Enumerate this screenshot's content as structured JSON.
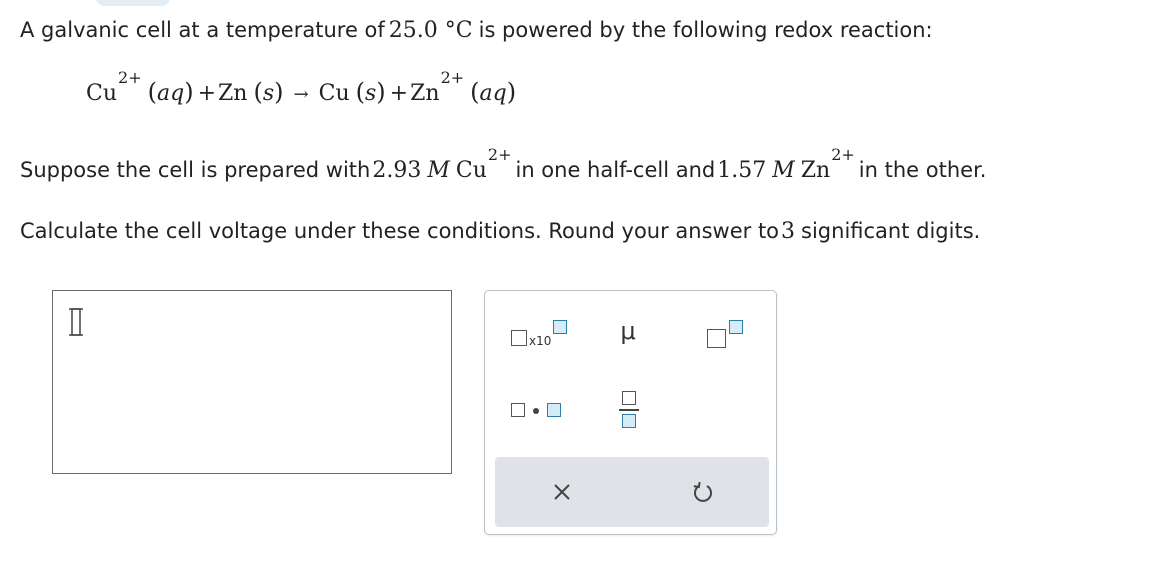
{
  "question": {
    "intro": "A galvanic cell at a temperature of 25.0 °C is powered by the following redox reaction:",
    "intro_prefix": "A galvanic cell at a temperature of ",
    "intro_temp": "25.0 °C",
    "intro_suffix": " is powered by the following redox reaction:",
    "reaction": {
      "reactant1": "Cu",
      "reactant1_charge": "2+",
      "reactant1_state": "aq",
      "plus": "+",
      "reactant2": "Zn",
      "reactant2_state": "s",
      "arrow": "→",
      "product1": "Cu",
      "product1_state": "s",
      "product2": "Zn",
      "product2_charge": "2+",
      "product2_state": "aq"
    },
    "conditions": {
      "prefix": "Suppose the cell is prepared with ",
      "conc1": "2.93",
      "unit": "M",
      "ion1": "Cu",
      "ion1_charge": "2+",
      "middle": " in one half-cell and ",
      "conc2": "1.57",
      "ion2": "Zn",
      "ion2_charge": "2+",
      "suffix": " in the other."
    },
    "instruction": {
      "prefix": "Calculate the cell voltage under these conditions. Round your answer to ",
      "sig_figs": "3",
      "suffix": " significant digits."
    }
  },
  "answer": {
    "value": ""
  },
  "palette": {
    "x10_label": "x10",
    "mu_label": "μ",
    "tools": [
      "scientific-notation",
      "micro-prefix",
      "superscript",
      "multiply-dot",
      "fraction",
      "clear",
      "undo"
    ]
  },
  "colors": {
    "accent_blue": "#2a7ea8",
    "accent_fill": "#d5ecf7",
    "palette_bottom": "#dfe3e8"
  }
}
